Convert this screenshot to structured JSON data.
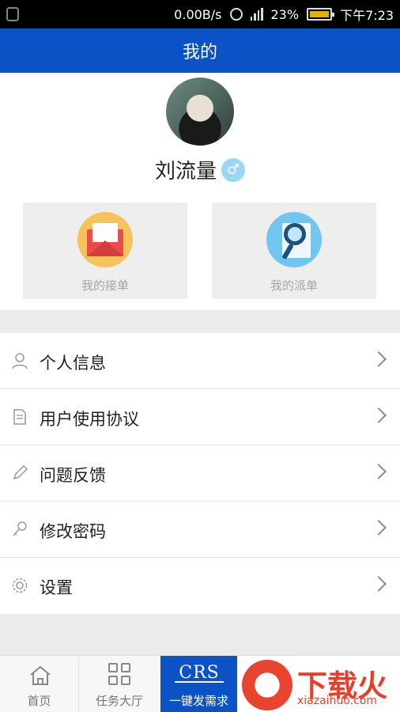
{
  "status_bar": {
    "speed": "0.00B/s",
    "network": "4G",
    "battery": "23%",
    "time": "下午7:23"
  },
  "title": "我的",
  "profile": {
    "name": "刘流量",
    "gender_symbol": "♂"
  },
  "cards": [
    {
      "label": "我的接单",
      "icon": "envelope-icon"
    },
    {
      "label": "我的派单",
      "icon": "magnifier-icon"
    }
  ],
  "menu": [
    {
      "label": "个人信息",
      "icon": "person-icon"
    },
    {
      "label": "用户使用协议",
      "icon": "document-icon"
    },
    {
      "label": "问题反馈",
      "icon": "pencil-icon"
    },
    {
      "label": "修改密码",
      "icon": "key-icon"
    },
    {
      "label": "设置",
      "icon": "gear-icon"
    }
  ],
  "tabs": [
    {
      "label": "首页",
      "icon": "home-icon"
    },
    {
      "label": "任务大厅",
      "icon": "grid-icon"
    },
    {
      "label": "一键发需求",
      "logo": "CRS"
    }
  ],
  "watermark": {
    "text": "下载火",
    "sub": "xiazaihuo.com"
  },
  "colors": {
    "primary": "#0b52c7",
    "background": "#ebebeb"
  }
}
